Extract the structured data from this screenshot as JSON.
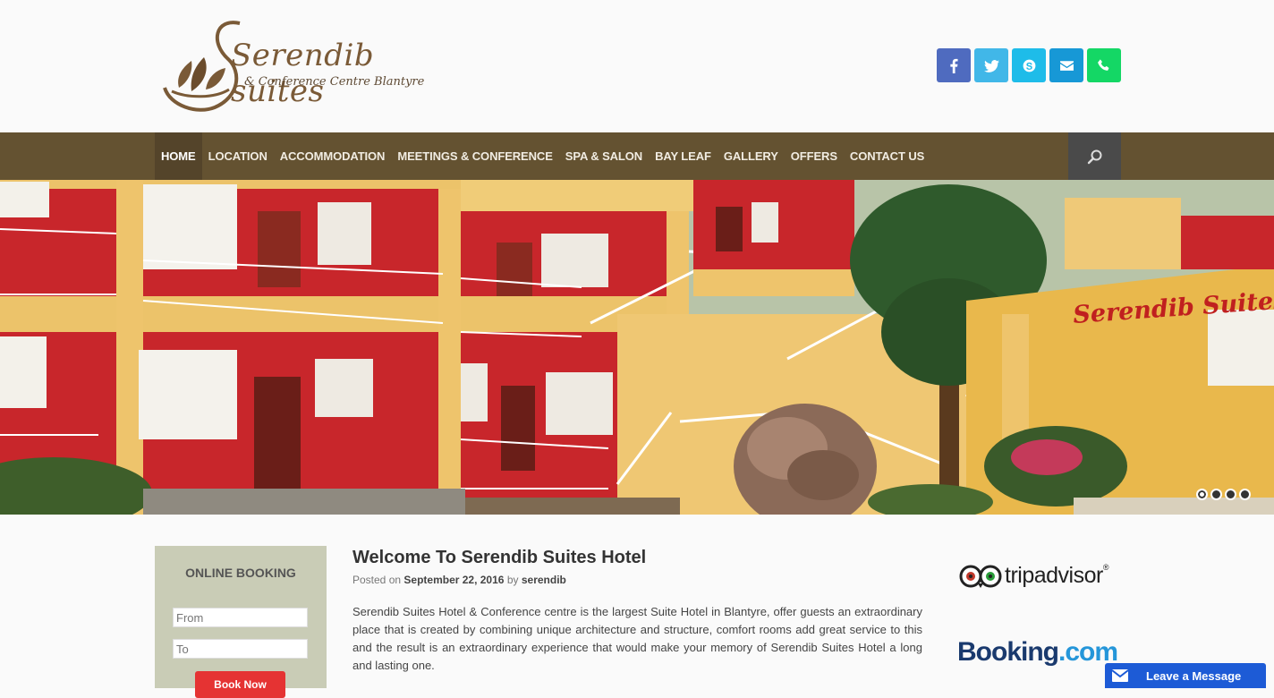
{
  "logo": {
    "title": "Serendib suites",
    "subtitle": "& Conference Centre Blantyre"
  },
  "social": [
    {
      "icon": "facebook-icon",
      "color": "#4f6bbf"
    },
    {
      "icon": "twitter-icon",
      "color": "#41b7e8"
    },
    {
      "icon": "skype-icon",
      "color": "#1ebce9"
    },
    {
      "icon": "email-icon",
      "color": "#1798d6"
    },
    {
      "icon": "phone-icon",
      "color": "#14d765"
    }
  ],
  "nav": {
    "items": [
      "HOME",
      "LOCATION",
      "ACCOMMODATION",
      "MEETINGS & CONFERENCE",
      "SPA & SALON",
      "BAY LEAF",
      "GALLERY",
      "OFFERS",
      "CONTACT US"
    ],
    "active": "HOME",
    "search_icon": "search-icon"
  },
  "hero": {
    "sign_text": "Serendib Suites",
    "slides": 4,
    "active_slide": 1
  },
  "booking": {
    "title": "ONLINE BOOKING",
    "from_placeholder": "From",
    "to_placeholder": "To",
    "button_label": "Book Now"
  },
  "post": {
    "title": "Welcome To Serendib Suites Hotel",
    "posted_on_label": "Posted on",
    "date": "September 22, 2016",
    "by_label": "by",
    "author": "serendib",
    "body": "Serendib Suites Hotel & Conference centre is the largest Suite Hotel in Blantyre, offer guests an extraordinary place that is created by combining unique architecture and structure, comfort rooms add great service to this and the result is an extraordinary experience that would make your memory of Serendib Suites Hotel a long and lasting one."
  },
  "sidebar": {
    "tripadvisor_text": "tripadvisor",
    "tripadvisor_reg": "®",
    "booking_part1": "Booking",
    "booking_part2": ".com"
  },
  "chat": {
    "label": "Leave a Message"
  }
}
